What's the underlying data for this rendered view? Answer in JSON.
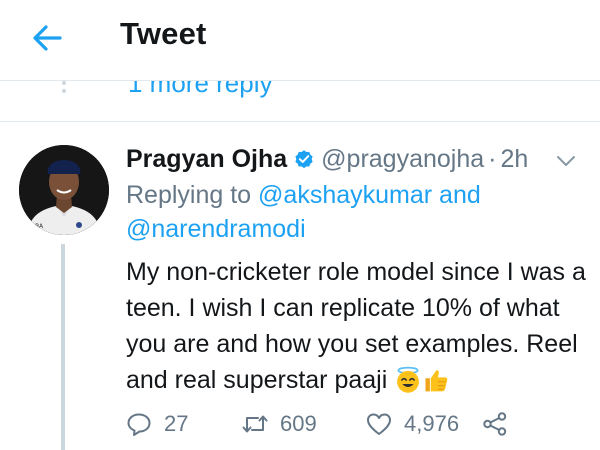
{
  "header": {
    "title": "Tweet",
    "back_icon": "arrow-left-icon"
  },
  "more_replies": {
    "label": "1 more reply"
  },
  "tweet": {
    "display_name": "Pragyan Ojha",
    "verified": true,
    "handle": "@pragyanojha",
    "separator": "·",
    "time": "2h",
    "replying_prefix": "Replying to",
    "mention_1": "@akshaykumar",
    "replying_and": "and",
    "mention_2": "@narendramodi",
    "text": "My non-cricketer role model since I was a teen. I wish I can replicate 10% of what you are and how you set examples. Reel and real superstar paaji",
    "emojis": [
      "smiling-face-with-halo",
      "thumbs-up"
    ]
  },
  "actions": {
    "reply_count": "27",
    "retweet_count": "609",
    "like_count": "4,976"
  },
  "colors": {
    "accent": "#1da1f2",
    "secondary_text": "#657786",
    "divider": "#e1e8ed",
    "thread_line": "#ccd6dd"
  }
}
